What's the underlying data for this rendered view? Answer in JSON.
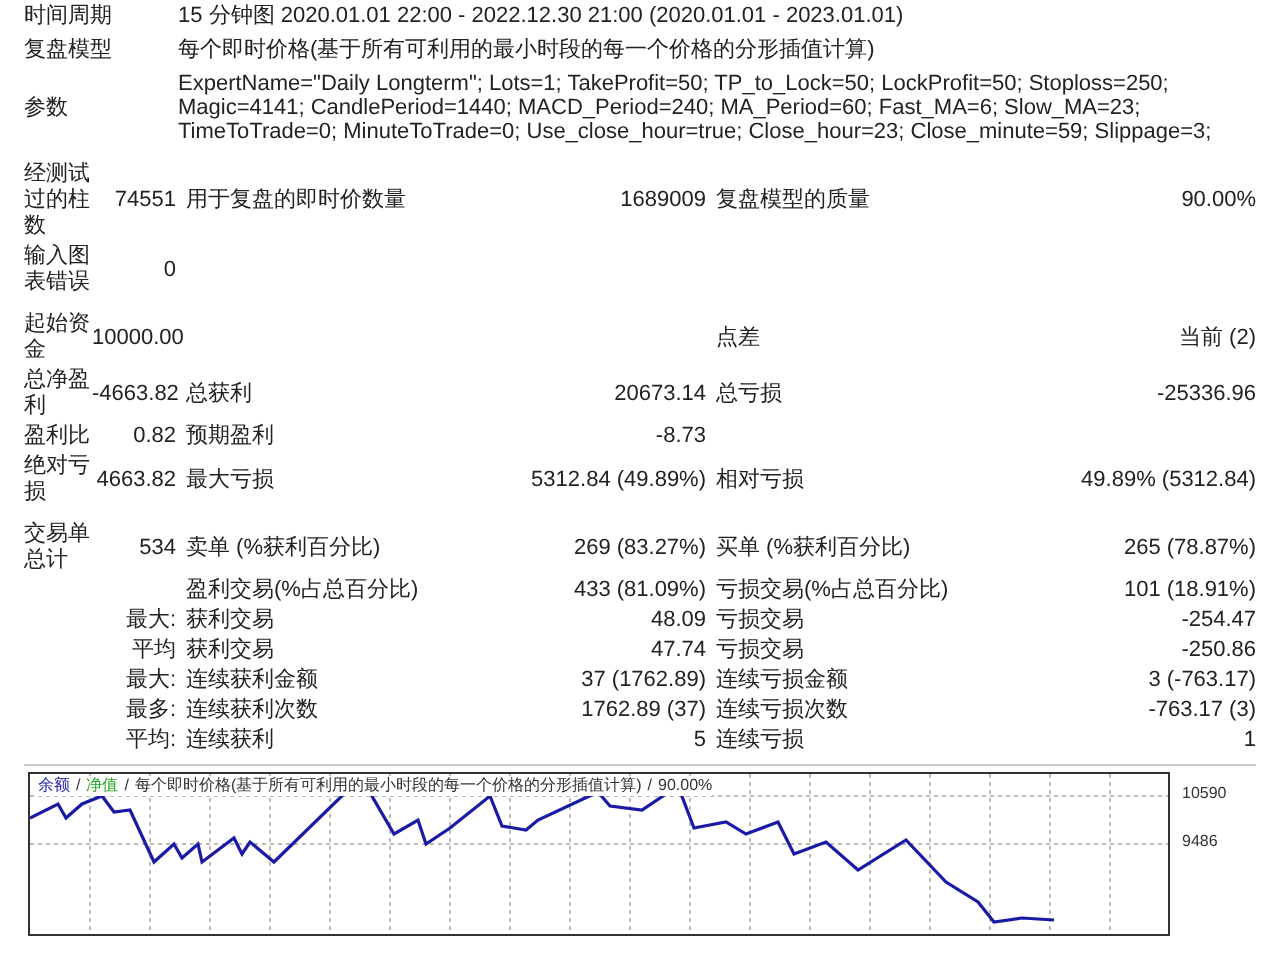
{
  "header": [
    {
      "label": "时间周期",
      "value": "15 分钟图 2020.01.01 22:00 - 2022.12.30 21:00 (2020.01.01 - 2023.01.01)"
    },
    {
      "label": "复盘模型",
      "value": "每个即时价格(基于所有可利用的最小时段的每一个价格的分形插值计算)"
    },
    {
      "label": "参数",
      "value": "ExpertName=\"Daily Longterm\"; Lots=1; TakeProfit=50; TP_to_Lock=50; LockProfit=50; Stoploss=250; Magic=4141; CandlePeriod=1440; MACD_Period=240; MA_Period=60; Fast_MA=6; Slow_MA=23; TimeToTrade=0; MinuteToTrade=0; Use_close_hour=true; Close_hour=23; Close_minute=59; Slippage=3;"
    }
  ],
  "sections": [
    {
      "rows": [
        {
          "label": "经测试过的柱数",
          "value": "74551",
          "items": [
            {
              "label": "用于复盘的即时价数量",
              "value": "1689009"
            },
            {
              "label": "复盘模型的质量",
              "value": "90.00%"
            }
          ]
        },
        {
          "label": "输入图表错误",
          "value": "0"
        }
      ]
    },
    {
      "rows": [
        {
          "label": "起始资金",
          "value": "10000.00",
          "items": [
            {
              "kind": "right",
              "label": "点差",
              "value": "当前 (2)"
            }
          ]
        },
        {
          "label": "总净盈利",
          "value": "-4663.82",
          "items": [
            {
              "label": "总获利",
              "value": "20673.14"
            },
            {
              "label": "总亏损",
              "value": "-25336.96"
            }
          ]
        },
        {
          "label": "盈利比",
          "value": "0.82",
          "items": [
            {
              "label": "预期盈利",
              "value": "-8.73"
            }
          ]
        },
        {
          "label": "绝对亏损",
          "value": "4663.82",
          "items": [
            {
              "label": "最大亏损",
              "value": "5312.84 (49.89%)"
            },
            {
              "label": "相对亏损",
              "value": "49.89% (5312.84)"
            }
          ]
        }
      ]
    },
    {
      "rows": [
        {
          "label": "交易单总计",
          "value": "534",
          "items": [
            {
              "label": "卖单 (%获利百分比)",
              "value": "269 (83.27%)"
            },
            {
              "label": "买单 (%获利百分比)",
              "value": "265 (78.87%)"
            }
          ]
        },
        {
          "items": [
            {
              "label": "盈利交易(%占总百分比)",
              "value": "433 (81.09%)"
            },
            {
              "label": "亏损交易(%占总百分比)",
              "value": "101 (18.91%)"
            }
          ]
        },
        {
          "value": "最大:",
          "items": [
            {
              "label": "获利交易",
              "value": "48.09"
            },
            {
              "label": "亏损交易",
              "value": "-254.47"
            }
          ]
        },
        {
          "value": "平均",
          "items": [
            {
              "label": "获利交易",
              "value": "47.74"
            },
            {
              "label": "亏损交易",
              "value": "-250.86"
            }
          ]
        },
        {
          "value": "最大:",
          "items": [
            {
              "label": "连续获利金额",
              "value": "37 (1762.89)"
            },
            {
              "label": "连续亏损金额",
              "value": "3 (-763.17)"
            }
          ]
        },
        {
          "value": "最多:",
          "items": [
            {
              "label": "连续获利次数",
              "value": "1762.89 (37)"
            },
            {
              "label": "连续亏损次数",
              "value": "-763.17 (3)"
            }
          ]
        },
        {
          "value": "平均:",
          "items": [
            {
              "label": "连续获利",
              "value": "5"
            },
            {
              "label": "连续亏损",
              "value": "1"
            }
          ]
        }
      ]
    }
  ],
  "chart": {
    "legend": [
      {
        "label": "余额",
        "color": "#1a1aa6"
      },
      {
        "label": "净值",
        "color": "#22aa22"
      }
    ],
    "separator": "/",
    "axis_labels": [
      "10590",
      "9486"
    ],
    "subtitle": "每个即时价格(基于所有可利用的最小时段的每一个价格的分形插值计算)",
    "quality": "90.00%"
  }
}
